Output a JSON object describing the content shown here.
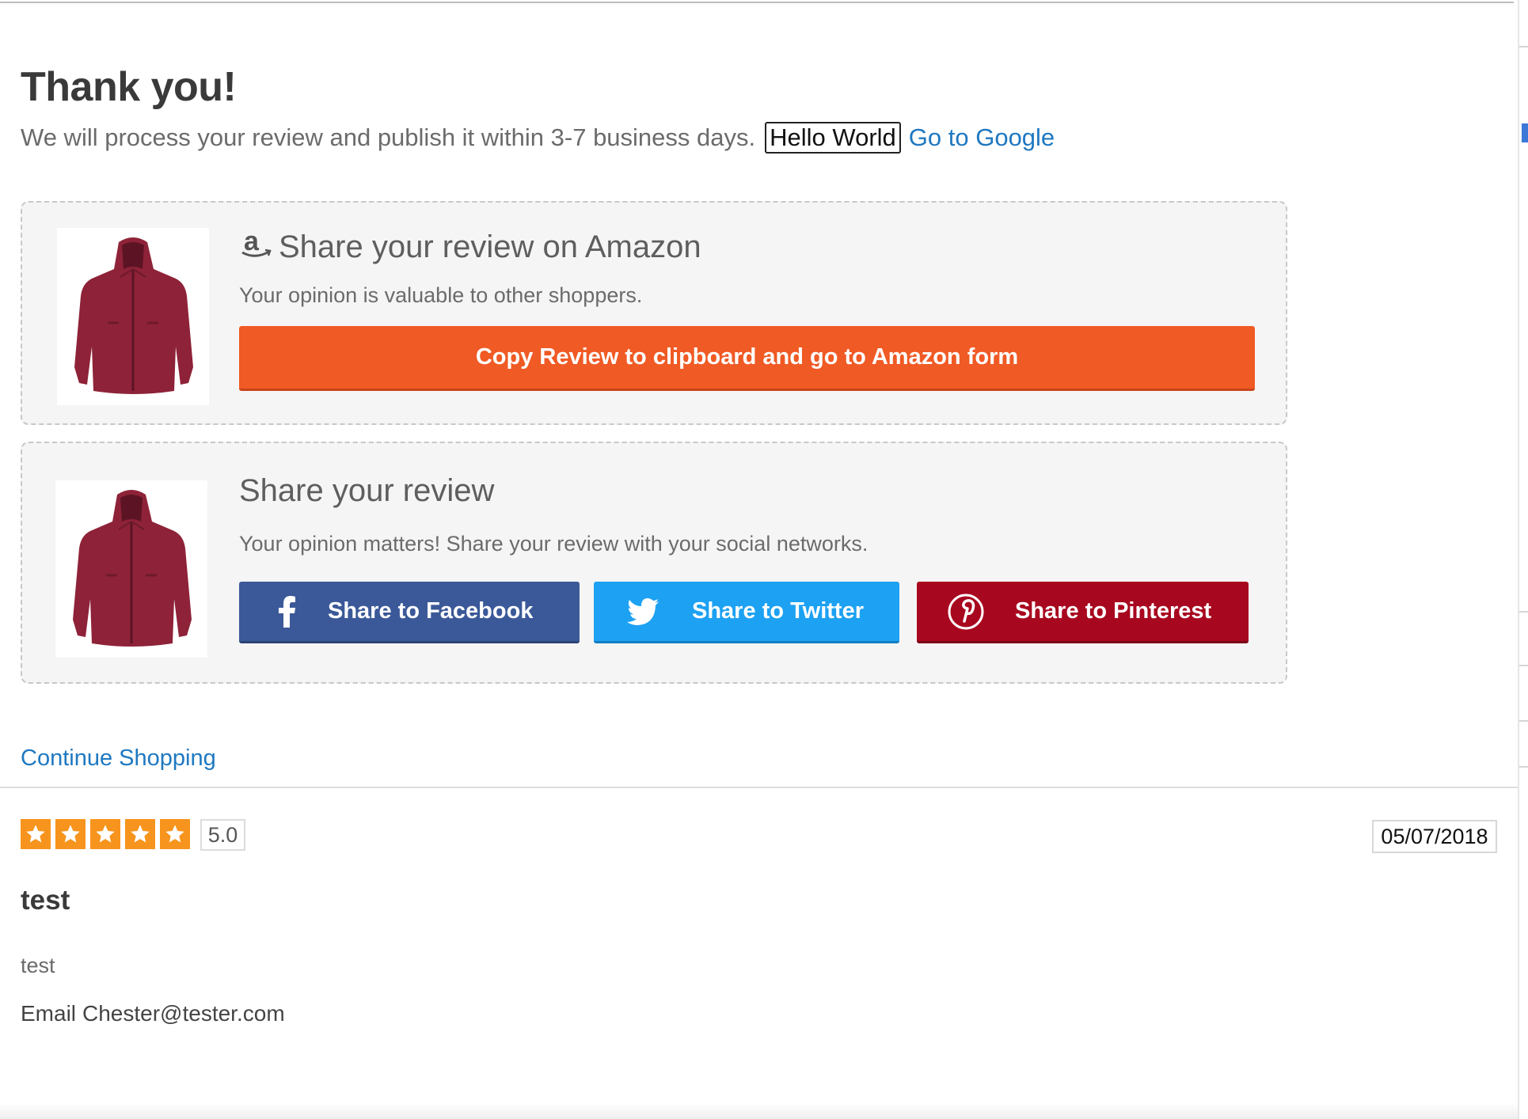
{
  "header": {
    "title": "Thank you!",
    "subtitle": "We will process your review and publish it within 3-7 business days.",
    "hello_text": "Hello World",
    "google_link": "Go to Google"
  },
  "amazon_card": {
    "heading": "Share your review on Amazon",
    "text": "Your opinion is valuable to other shoppers.",
    "button_label": "Copy Review to clipboard and go to Amazon form",
    "icon": "amazon-logo-icon",
    "product_image": "red-jacket-image"
  },
  "social_card": {
    "heading": "Share your review",
    "text": "Your opinion matters! Share your review with your social networks.",
    "product_image": "red-jacket-image",
    "buttons": [
      {
        "label": "Share to Facebook",
        "icon": "facebook-icon",
        "color": "#3b5998"
      },
      {
        "label": "Share to Twitter",
        "icon": "twitter-icon",
        "color": "#1da1f2"
      },
      {
        "label": "Share to Pinterest",
        "icon": "pinterest-icon",
        "color": "#a8081f"
      }
    ]
  },
  "continue_link": "Continue Shopping",
  "review": {
    "stars": 5,
    "rating": "5.0",
    "date": "05/07/2018",
    "title": "test",
    "body": "test",
    "email_label": "Email",
    "email": "Chester@tester.com"
  },
  "colors": {
    "amazon_button": "#f05a24",
    "link": "#1f78c1",
    "star": "#f7941d",
    "card_bg": "#f5f5f5"
  }
}
